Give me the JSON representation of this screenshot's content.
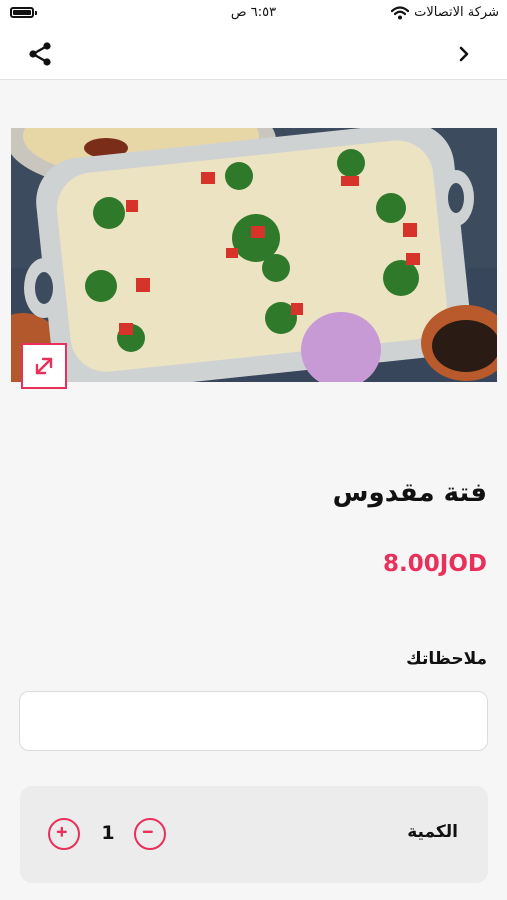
{
  "status_bar": {
    "carrier": "شركة الاتصالات",
    "time": "٦:٥٣ ص"
  },
  "nav": {
    "share_icon": "share-icon",
    "back_icon": "chevron-right-icon"
  },
  "product": {
    "name": "فتة مقدوس",
    "price": "8.00JOD",
    "expand_icon": "expand-arrows-icon"
  },
  "notes": {
    "label": "ملاحظاتك",
    "value": "",
    "placeholder": ""
  },
  "quantity": {
    "label": "الكمية",
    "value": "1",
    "plus_icon": "plus-circle-icon",
    "minus_icon": "minus-circle-icon"
  },
  "colors": {
    "accent": "#e8305a",
    "background": "#f6f6f6",
    "panel": "#ececec"
  }
}
